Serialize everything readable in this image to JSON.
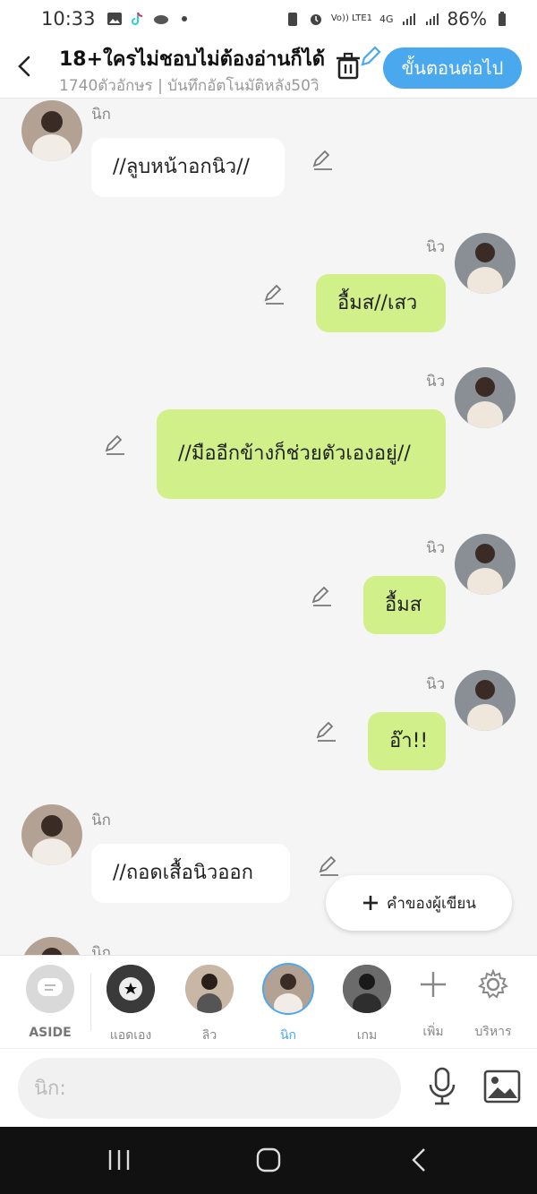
{
  "status_bar": {
    "time": "10:33",
    "network": "Vo)) LTE1",
    "network_type": "4G",
    "battery": "86%"
  },
  "header": {
    "title": "18+ใครไม่ชอบไม่ต้องอ่านก็ได้",
    "subtitle": "1740ตัวอักษร | บันทึกอัตโนมัติหลัง50วิ",
    "next_label": "ขั้นตอนต่อไป"
  },
  "messages": [
    {
      "side": "left",
      "name": "นิก",
      "text": "//ลูบหน้าอกนิว//"
    },
    {
      "side": "right",
      "name": "นิว",
      "text": "อื้มส//เสว"
    },
    {
      "side": "right",
      "name": "นิว",
      "text": "//มืออีกข้างก็ช่วยตัวเองอยู่//"
    },
    {
      "side": "right",
      "name": "นิว",
      "text": "อื้มส"
    },
    {
      "side": "right",
      "name": "นิว",
      "text": "อ๊า!!"
    },
    {
      "side": "left",
      "name": "นิก",
      "text": "//ถอดเสื้อนิวออก"
    },
    {
      "side": "left",
      "name": "นิก",
      "text": ""
    }
  ],
  "fab": {
    "label": "คำของผู้เขียน"
  },
  "characters": [
    {
      "label": "ASIDE",
      "active": false
    },
    {
      "label": "แอดเอง",
      "active": false
    },
    {
      "label": "ลิว",
      "active": false
    },
    {
      "label": "นิก",
      "active": true
    },
    {
      "label": "เกม",
      "active": false
    },
    {
      "label": "เพิ่ม",
      "active": false
    },
    {
      "label": "บริหาร",
      "active": false
    }
  ],
  "input": {
    "placeholder": "นิก:"
  },
  "colors": {
    "accent": "#4aa8ee",
    "bubble_right": "#d2f08a",
    "bubble_left": "#ffffff"
  }
}
